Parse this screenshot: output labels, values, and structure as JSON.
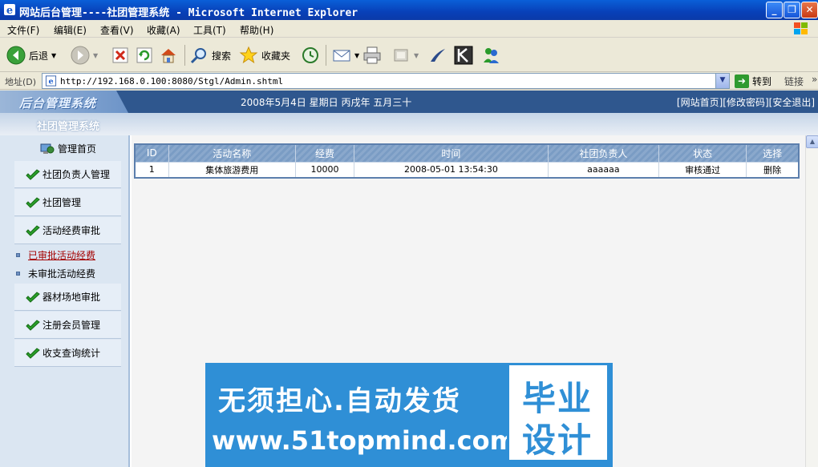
{
  "window": {
    "title": "网站后台管理----社团管理系统 - Microsoft Internet Explorer",
    "minimize_label": "_",
    "maximize_label": "❐",
    "close_label": "✕"
  },
  "menu": [
    "文件(F)",
    "编辑(E)",
    "查看(V)",
    "收藏(A)",
    "工具(T)",
    "帮助(H)"
  ],
  "toolbar": {
    "back_label": "后退",
    "search_label": "搜索",
    "favorites_label": "收藏夹"
  },
  "address": {
    "label": "地址(D)",
    "url": "http://192.168.0.100:8080/Stgl/Admin.shtml",
    "go_label": "转到",
    "links_label": "链接",
    "more": "»"
  },
  "header": {
    "logo": "后台管理系统",
    "date": "2008年5月4日 星期日 丙戌年 五月三十",
    "links": "[网站首页][修改密码][安全退出]",
    "system_name": "社团管理系统"
  },
  "sidebar": {
    "home": "管理首页",
    "items": [
      "社团负责人管理",
      "社团管理",
      "活动经费审批",
      "器材场地审批",
      "注册会员管理",
      "收支查询统计"
    ],
    "subitems": [
      {
        "label": "已审批活动经费",
        "active": true
      },
      {
        "label": "未审批活动经费",
        "active": false
      }
    ]
  },
  "table": {
    "headers": [
      "ID",
      "活动名称",
      "经费",
      "时间",
      "社团负责人",
      "状态",
      "选择"
    ],
    "rows": [
      [
        "1",
        "集体旅游费用",
        "10000",
        "2008-05-01 13:54:30",
        "aaaaaa",
        "审核通过",
        "删除"
      ]
    ]
  },
  "banner": {
    "line1": "无须担心.自动发货",
    "line2": "www.51topmind.com",
    "right1": "毕业",
    "right2": "设计"
  },
  "colors": {
    "header_bg": "#2f578e",
    "sidebar_bg": "#dbe6f2",
    "banner_bg": "#2f8fd6",
    "active_link": "#a40000"
  }
}
